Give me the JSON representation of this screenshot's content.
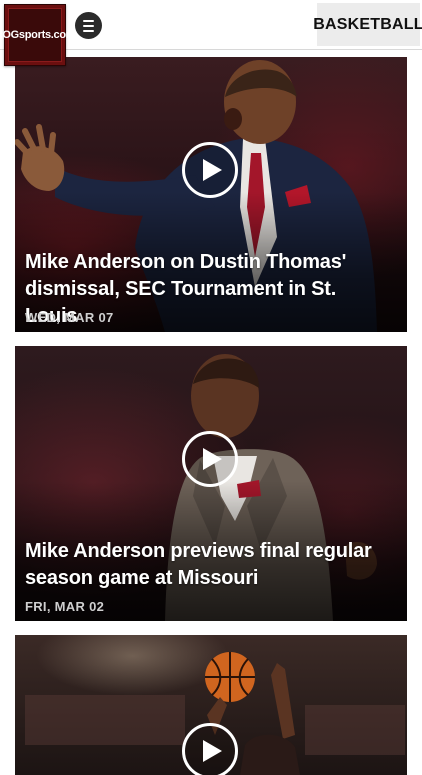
{
  "header": {
    "logo_text": "HOGsports.com",
    "section_label": "BASKETBALL"
  },
  "feed": {
    "items": [
      {
        "title": "Mike Anderson on Dustin Thomas' dismissal, SEC Tournament in St. Louis",
        "date": "WED, MAR 07"
      },
      {
        "title": "Mike Anderson previews final regular season game at Missouri",
        "date": "FRI, MAR 02"
      },
      {
        "title": "",
        "date": ""
      }
    ]
  },
  "colors": {
    "accent": "#c8102e",
    "menu_button": "#2b2b2b",
    "section_button_bg": "#ececec"
  },
  "icons": {
    "menu": "hamburger-icon",
    "play": "play-icon"
  }
}
